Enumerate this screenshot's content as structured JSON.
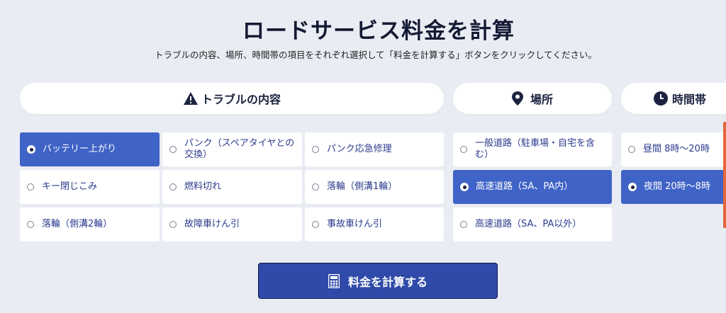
{
  "page": {
    "title": "ロードサービス料金を計算",
    "subtitle": "トラブルの内容、場所、時間帯の項目をそれぞれ選択して「料金を計算する」ボタンをクリックしてください。"
  },
  "categories": {
    "trouble": {
      "label": "トラブルの内容",
      "icon": "warning-icon"
    },
    "location": {
      "label": "場所",
      "icon": "location-pin-icon"
    },
    "time": {
      "label": "時間帯",
      "icon": "clock-icon"
    }
  },
  "trouble_options": [
    {
      "label": "バッテリー上がり",
      "selected": true
    },
    {
      "label": "パンク（スペアタイヤとの交換）",
      "selected": false
    },
    {
      "label": "パンク応急修理",
      "selected": false
    },
    {
      "label": "キー閉じこみ",
      "selected": false
    },
    {
      "label": "燃料切れ",
      "selected": false
    },
    {
      "label": "落輪（側溝1輪）",
      "selected": false
    },
    {
      "label": "落輪（側溝2輪）",
      "selected": false
    },
    {
      "label": "故障車けん引",
      "selected": false
    },
    {
      "label": "事故車けん引",
      "selected": false
    }
  ],
  "location_options": [
    {
      "label": "一般道路（駐車場・自宅を含む）",
      "selected": false
    },
    {
      "label": "高速道路（SA、PA内）",
      "selected": true
    },
    {
      "label": "高速道路（SA、PA以外）",
      "selected": false
    }
  ],
  "time_options": [
    {
      "label": "昼間 8時〜20時",
      "selected": false
    },
    {
      "label": "夜間 20時〜8時",
      "selected": true
    }
  ],
  "calculate_button": {
    "label": "料金を計算する",
    "icon": "calculator-icon"
  },
  "colors": {
    "accent": "#3f63c6",
    "button": "#2f4aa8",
    "background": "#e9ecf3"
  }
}
